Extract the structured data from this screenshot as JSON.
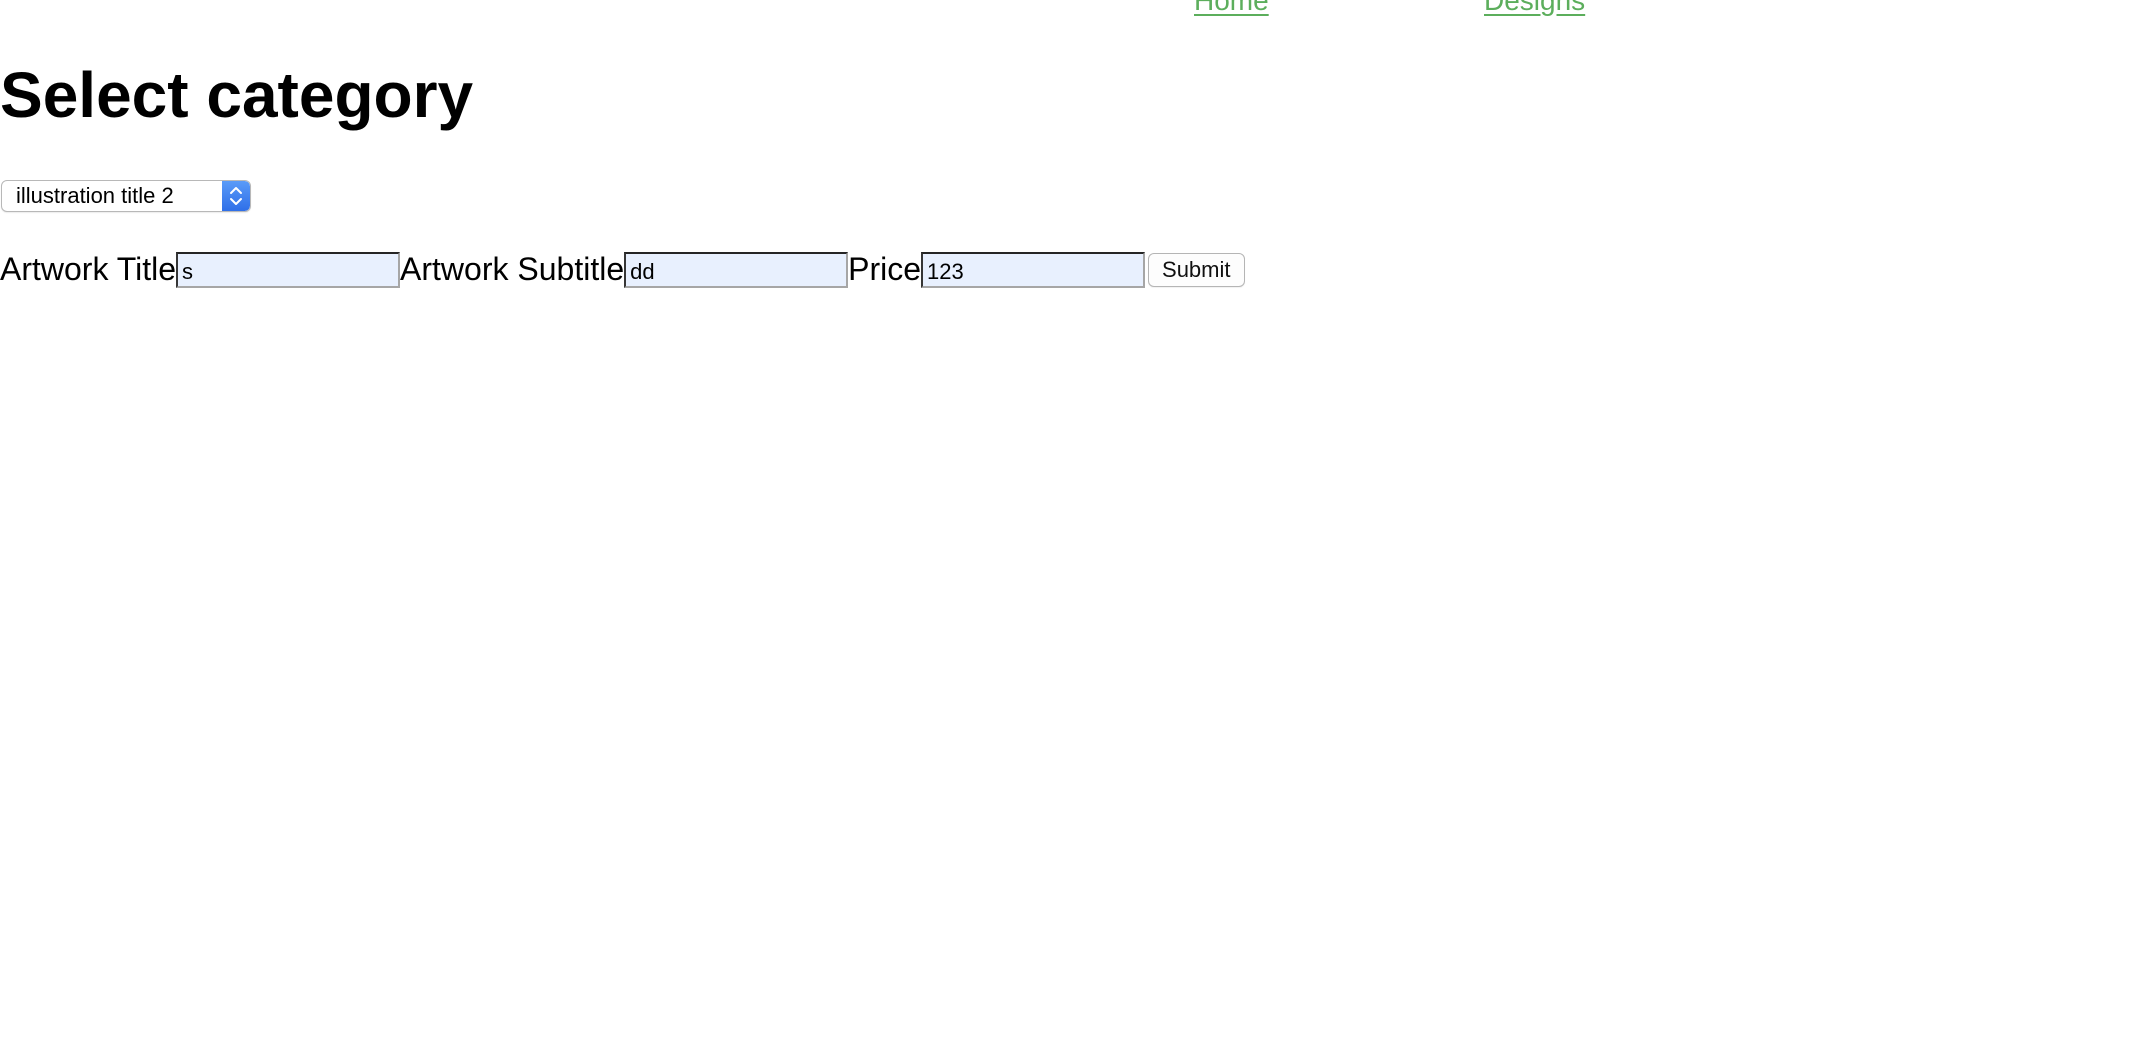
{
  "nav": {
    "home_label": "Home",
    "designs_label": "Designs",
    "link_color": "#5cae5c"
  },
  "heading": {
    "title": "Select category"
  },
  "category_select": {
    "selected": "illustration title 2",
    "accent_color": "#3b82f6"
  },
  "form": {
    "artwork_title_label": "Artwork Title",
    "artwork_title_value": "s",
    "artwork_subtitle_label": "Artwork Subtitle",
    "artwork_subtitle_value": "dd",
    "price_label": "Price",
    "price_value": "123",
    "submit_label": "Submit",
    "input_bg_color": "#e8f0fe"
  }
}
